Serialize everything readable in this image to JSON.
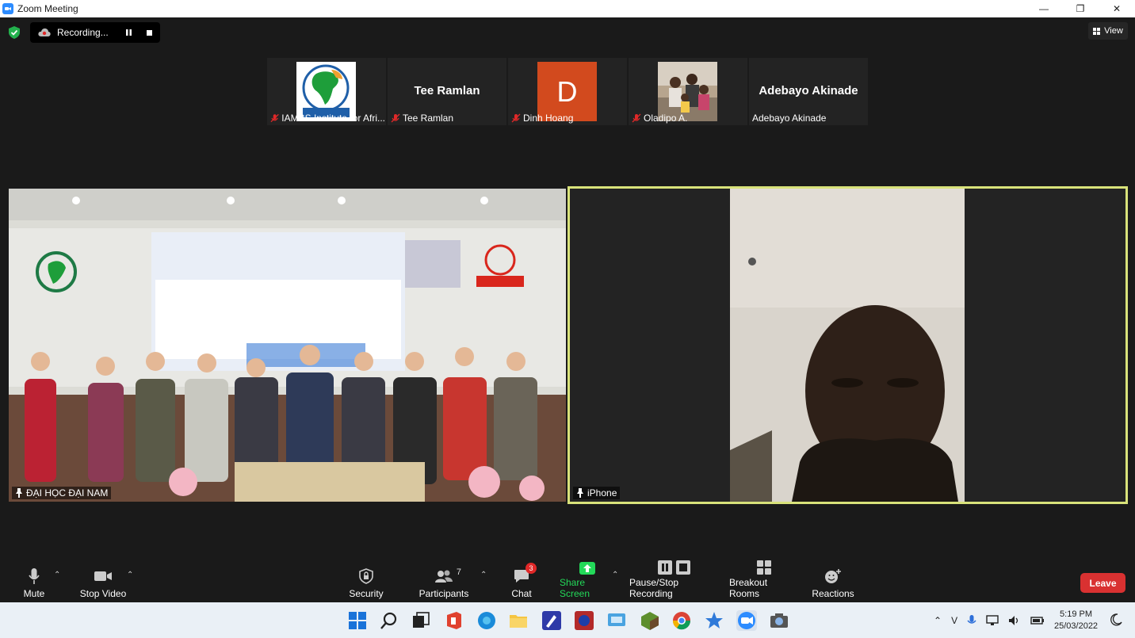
{
  "window": {
    "title": "Zoom Meeting",
    "minimize": "—",
    "maximize": "❐",
    "close": "✕"
  },
  "recording": {
    "label": "Recording..."
  },
  "view_button": {
    "label": "View"
  },
  "participants_strip": [
    {
      "name": "IAMBS Institute for Afri...",
      "display": "logo"
    },
    {
      "name": "Tee Ramlan",
      "display": "text",
      "big_name": "Tee Ramlan"
    },
    {
      "name": "Dinh Hoang",
      "display": "initial",
      "initial": "D"
    },
    {
      "name": "Oladipo A.",
      "display": "photo"
    },
    {
      "name": "Adebayo Akinade",
      "display": "text",
      "big_name": "Adebayo Akinade"
    }
  ],
  "videos": {
    "left": {
      "label": "ĐẠI HỌC ĐẠI NAM"
    },
    "right": {
      "label": "iPhone"
    }
  },
  "toolbar": {
    "mute": "Mute",
    "stop_video": "Stop Video",
    "security": "Security",
    "participants": "Participants",
    "participants_count": "7",
    "chat": "Chat",
    "chat_badge": "3",
    "share_screen": "Share Screen",
    "pause_stop_recording": "Pause/Stop Recording",
    "breakout_rooms": "Breakout Rooms",
    "reactions": "Reactions",
    "leave": "Leave"
  },
  "taskbar": {
    "time": "5:19 PM",
    "date": "25/03/2022"
  },
  "colors": {
    "active_speaker_border": "#d8e27a",
    "leave_button": "#d93131",
    "share_screen_green": "#23d959",
    "zoom_blue": "#2d8cff"
  }
}
